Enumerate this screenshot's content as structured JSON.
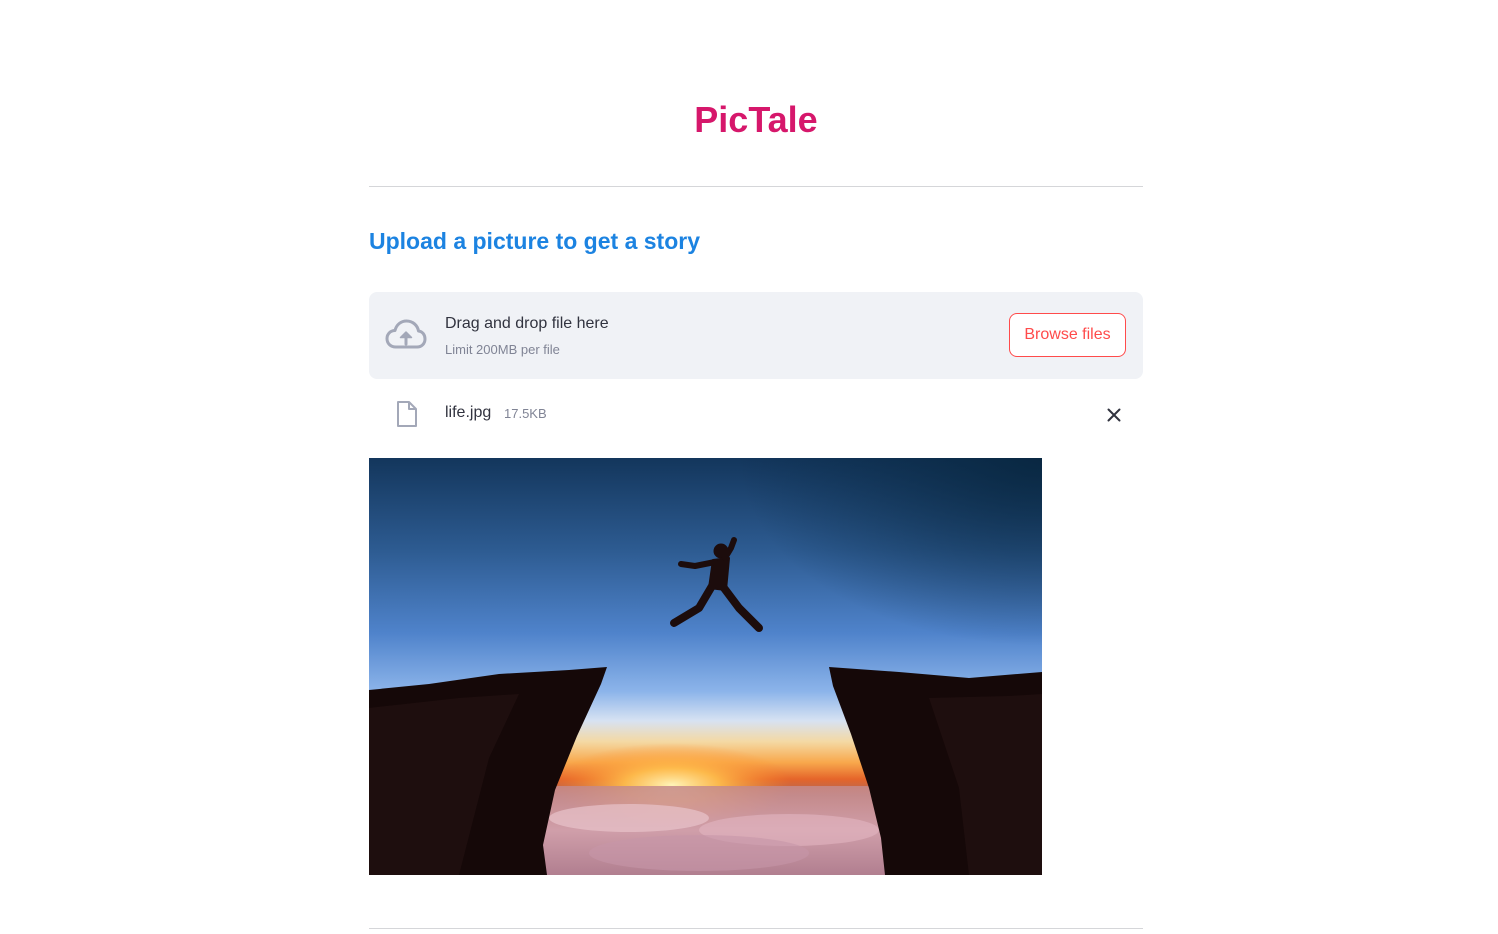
{
  "app": {
    "title": "PicTale"
  },
  "upload": {
    "heading": "Upload a picture to get a story",
    "dropzone_text": "Drag and drop file here",
    "limit_text": "Limit 200MB per file",
    "browse_label": "Browse files",
    "icon": "cloud-upload-icon"
  },
  "file": {
    "name": "life.jpg",
    "size": "17.5KB",
    "icon": "file-icon",
    "remove_icon": "close-icon"
  },
  "preview": {
    "subject": "silhouette jumping between two cliffs at sunset"
  },
  "colors": {
    "title": "#d6176b",
    "heading": "#1c83e1",
    "accent": "#ff4b4b",
    "dropzone_bg": "#f0f2f6"
  }
}
